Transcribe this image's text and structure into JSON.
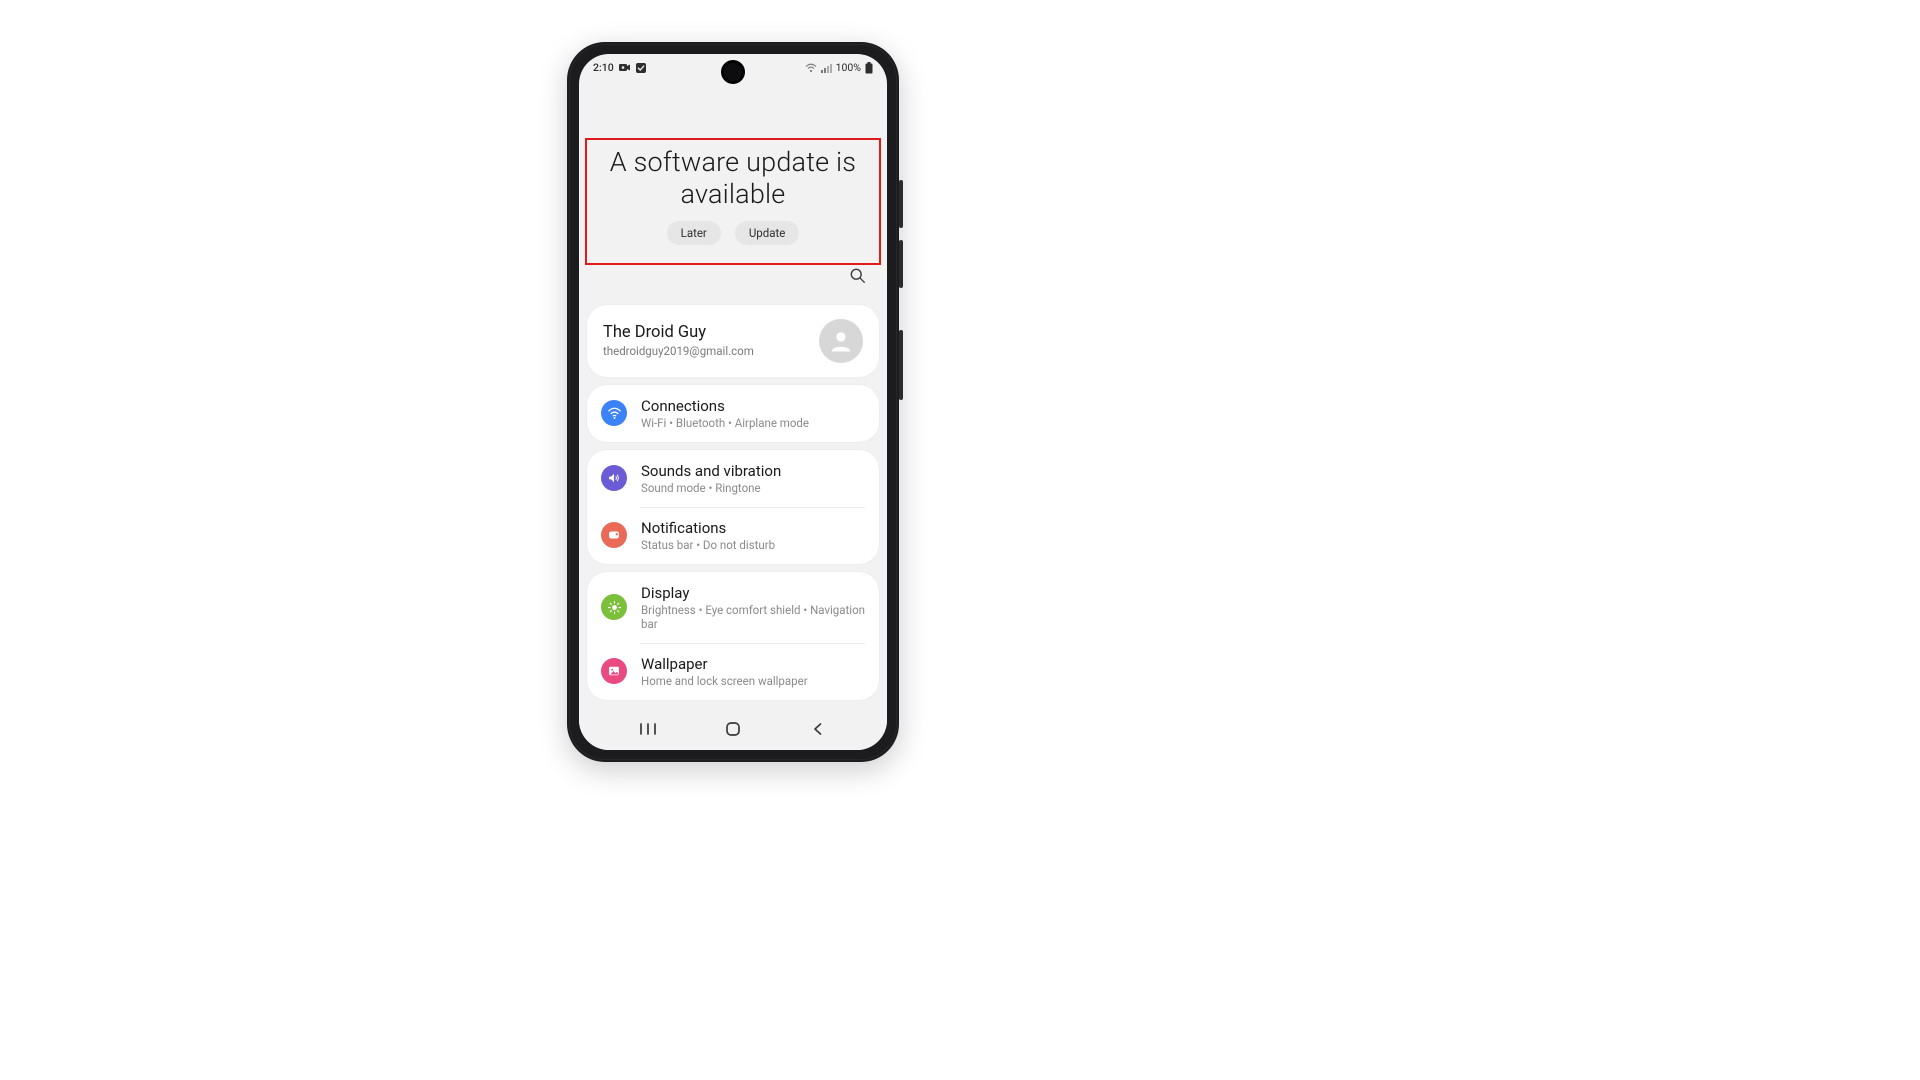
{
  "status": {
    "time": "2:10",
    "battery_pct": "100%"
  },
  "update": {
    "title": "A software update is available",
    "later": "Later",
    "update": "Update"
  },
  "account": {
    "name": "The Droid Guy",
    "email": "thedroidguy2019@gmail.com"
  },
  "settings": {
    "connections": {
      "title": "Connections",
      "sub": "Wi-Fi  •  Bluetooth  •  Airplane mode"
    },
    "sounds": {
      "title": "Sounds and vibration",
      "sub": "Sound mode  •  Ringtone"
    },
    "notifs": {
      "title": "Notifications",
      "sub": "Status bar  •  Do not disturb"
    },
    "display": {
      "title": "Display",
      "sub": "Brightness  •  Eye comfort shield  •  Navigation bar"
    },
    "wallpaper": {
      "title": "Wallpaper",
      "sub": "Home and lock screen wallpaper"
    }
  }
}
